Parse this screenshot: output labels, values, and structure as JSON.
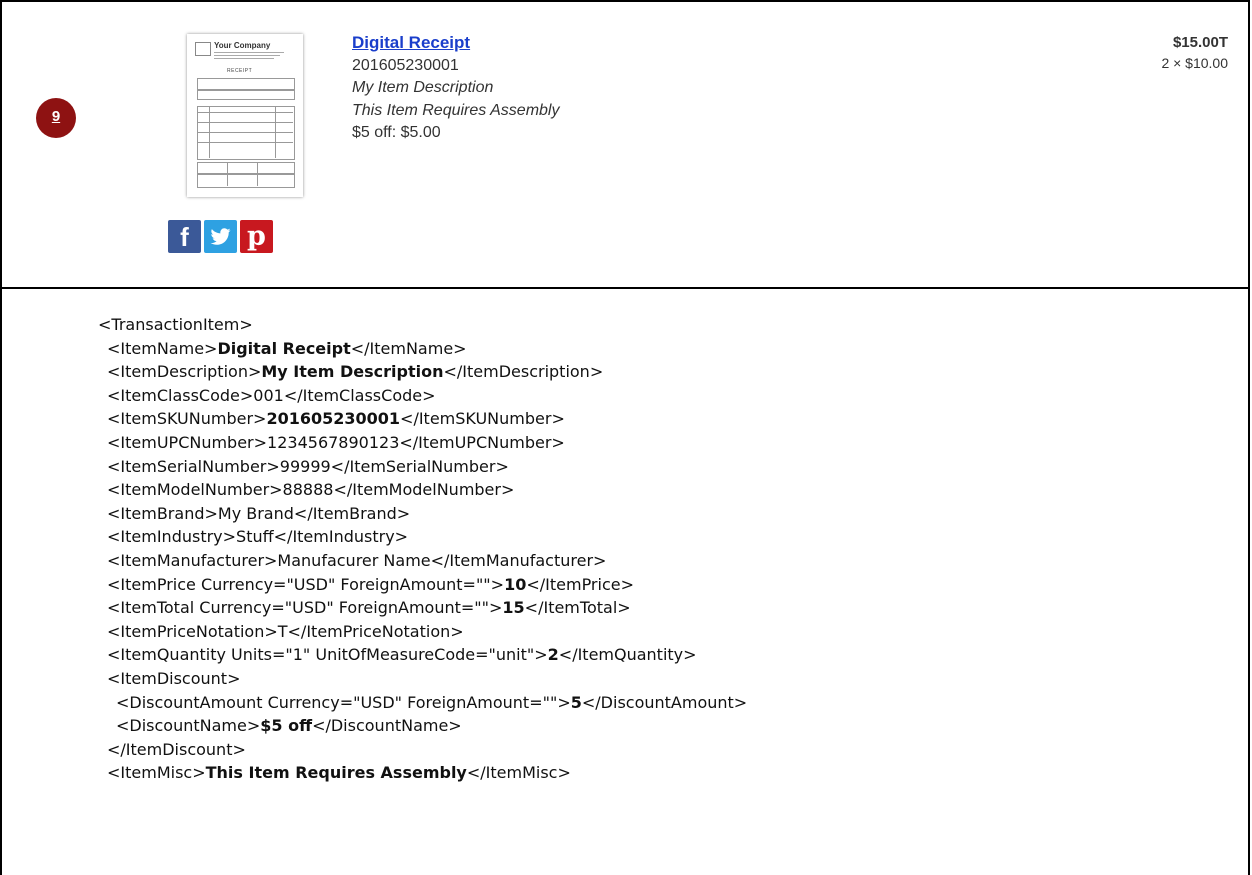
{
  "item": {
    "badge": "9",
    "thumbnail": {
      "company": "Your Company",
      "receipt_title": "RECEIPT"
    },
    "name": "Digital Receipt",
    "sku": "201605230001",
    "description": "My Item Description",
    "misc": "This Item Requires Assembly",
    "discount_line": "$5 off: $5.00",
    "price": "$15.00T",
    "quantity_line": "2 × $10.00",
    "social": {
      "facebook": "f",
      "pinterest": "p"
    }
  },
  "xml_lines": [
    {
      "indent": 0,
      "pre": "<TransactionItem>",
      "bold": "",
      "post": ""
    },
    {
      "indent": 1,
      "pre": "<ItemName>",
      "bold": "Digital Receipt",
      "post": "</ItemName>"
    },
    {
      "indent": 1,
      "pre": "<ItemDescription>",
      "bold": "My Item Description",
      "post": "</ItemDescription>"
    },
    {
      "indent": 1,
      "pre": "<ItemClassCode>001</ItemClassCode>",
      "bold": "",
      "post": ""
    },
    {
      "indent": 1,
      "pre": "<ItemSKUNumber>",
      "bold": "201605230001",
      "post": "</ItemSKUNumber>"
    },
    {
      "indent": 1,
      "pre": "<ItemUPCNumber>1234567890123</ItemUPCNumber>",
      "bold": "",
      "post": ""
    },
    {
      "indent": 1,
      "pre": "<ItemSerialNumber>99999</ItemSerialNumber>",
      "bold": "",
      "post": ""
    },
    {
      "indent": 1,
      "pre": "<ItemModelNumber>88888</ItemModelNumber>",
      "bold": "",
      "post": ""
    },
    {
      "indent": 1,
      "pre": "<ItemBrand>My Brand</ItemBrand>",
      "bold": "",
      "post": ""
    },
    {
      "indent": 1,
      "pre": "<ItemIndustry>Stuff</ItemIndustry>",
      "bold": "",
      "post": ""
    },
    {
      "indent": 1,
      "pre": "<ItemManufacturer>Manufacurer Name</ItemManufacturer>",
      "bold": "",
      "post": ""
    },
    {
      "indent": 1,
      "pre": "<ItemPrice Currency=\"USD\" ForeignAmount=\"\">",
      "bold": "10",
      "post": "</ItemPrice>"
    },
    {
      "indent": 1,
      "pre": "<ItemTotal Currency=\"USD\" ForeignAmount=\"\">",
      "bold": "15",
      "post": "</ItemTotal>"
    },
    {
      "indent": 1,
      "pre": "<ItemPriceNotation>T</ItemPriceNotation>",
      "bold": "",
      "post": ""
    },
    {
      "indent": 1,
      "pre": "<ItemQuantity Units=\"1\" UnitOfMeasureCode=\"unit\">",
      "bold": "2",
      "post": "</ItemQuantity>"
    },
    {
      "indent": 1,
      "pre": "<ItemDiscount>",
      "bold": "",
      "post": ""
    },
    {
      "indent": 2,
      "pre": "<DiscountAmount Currency=\"USD\" ForeignAmount=\"\">",
      "bold": "5",
      "post": "</DiscountAmount>"
    },
    {
      "indent": 2,
      "pre": "<DiscountName>",
      "bold": "$5 off",
      "post": "</DiscountName>"
    },
    {
      "indent": 1,
      "pre": "</ItemDiscount>",
      "bold": "",
      "post": ""
    },
    {
      "indent": 1,
      "pre": "<ItemMisc>",
      "bold": "This Item Requires Assembly",
      "post": "</ItemMisc>"
    }
  ]
}
